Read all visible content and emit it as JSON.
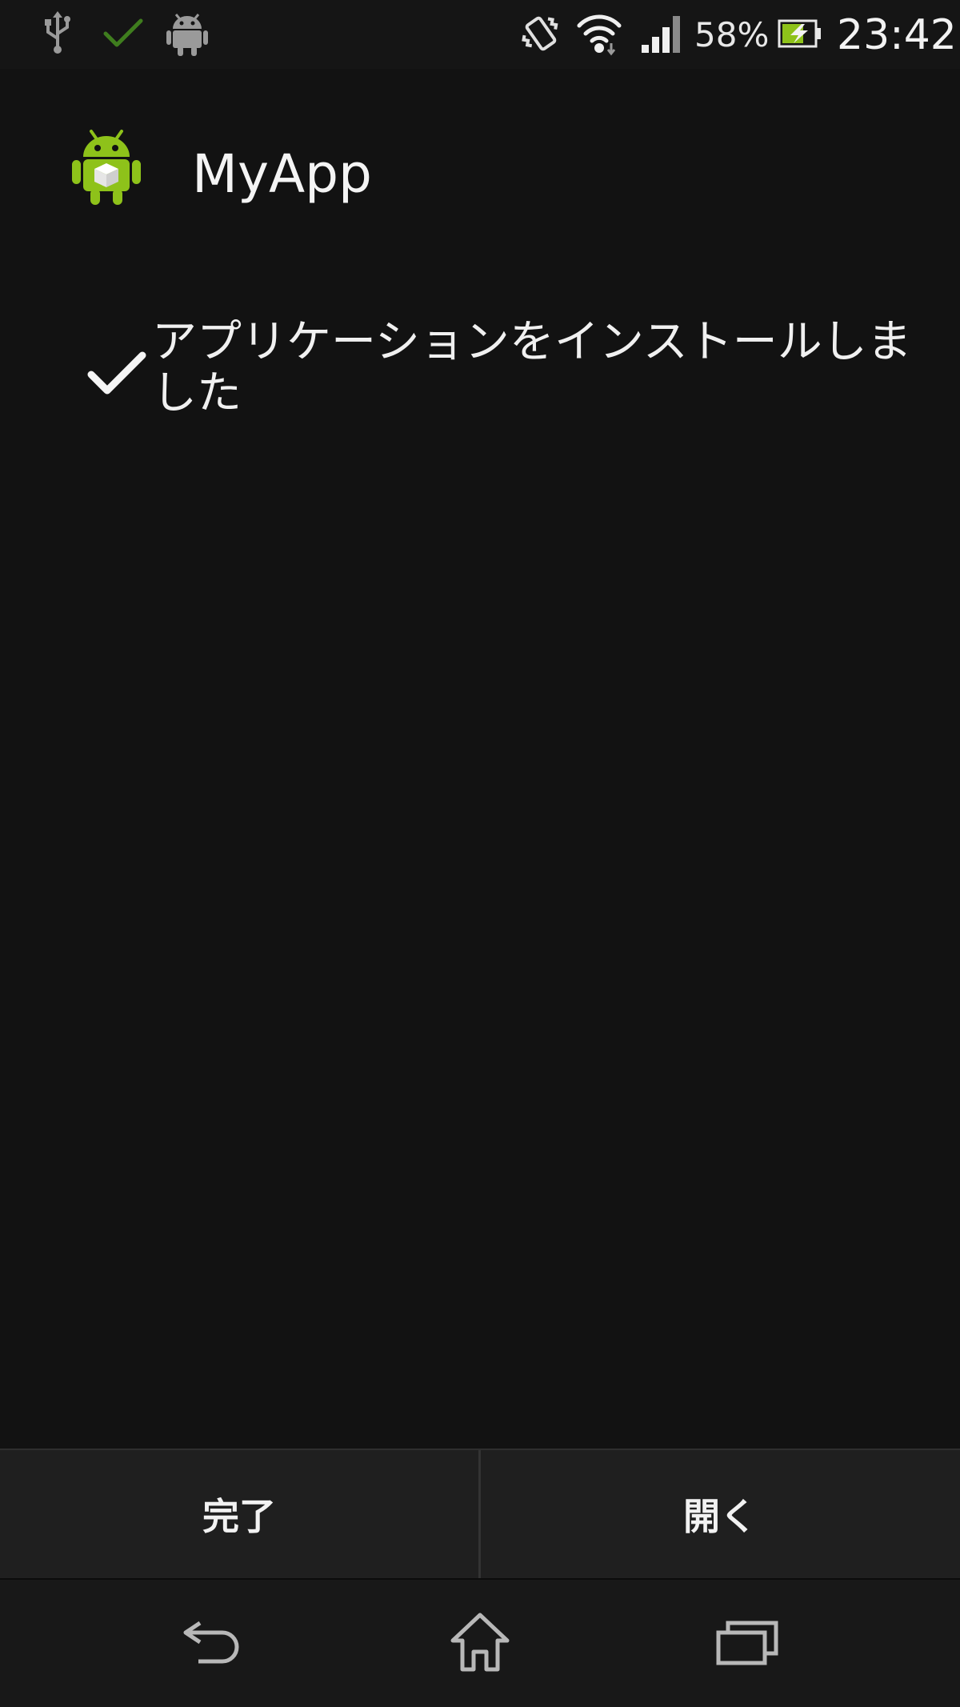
{
  "status_bar": {
    "battery_percent": "58%",
    "time": "23:42",
    "icons": [
      "usb-icon",
      "check-notification-icon",
      "android-notification-icon",
      "vibrate-icon",
      "wifi-icon",
      "signal-icon",
      "battery-charging-icon"
    ]
  },
  "app": {
    "title": "MyApp",
    "icon": "android-app-icon"
  },
  "install": {
    "status_text": "アプリケーションをインストールしました",
    "status_icon": "checkmark-icon"
  },
  "buttons": {
    "done_label": "完了",
    "open_label": "開く"
  },
  "nav": {
    "back": "back-icon",
    "home": "home-icon",
    "recents": "recents-icon"
  },
  "colors": {
    "background": "#121212",
    "android_green": "#8ec21a",
    "notification_check": "#3f7d1e"
  }
}
